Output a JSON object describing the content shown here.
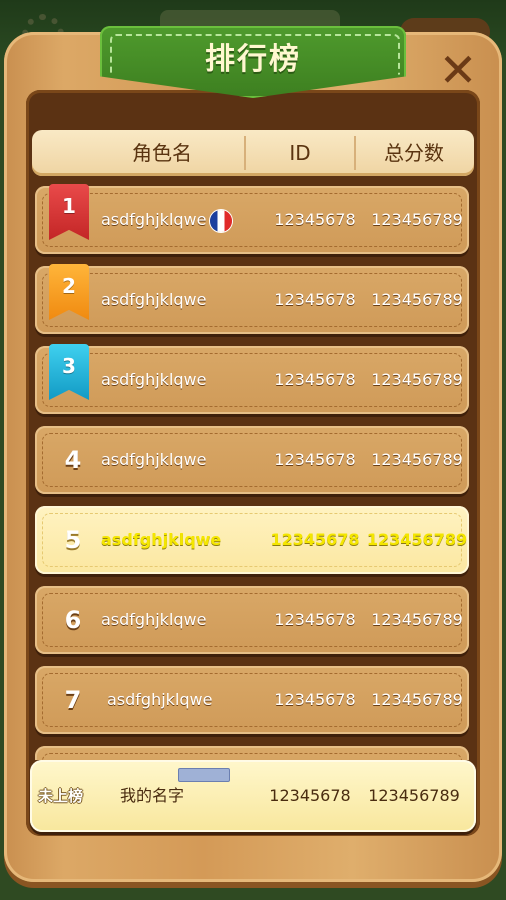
{
  "window": {
    "title": "排行榜"
  },
  "header": {
    "col_name": "角色名",
    "col_id": "ID",
    "col_score": "总分数"
  },
  "rows": [
    {
      "rank": "1",
      "name": "asdfghjklqwe",
      "id": "12345678",
      "score": "123456789",
      "badge": "red",
      "flag": "france-flag-icon"
    },
    {
      "rank": "2",
      "name": "asdfghjklqwe",
      "id": "12345678",
      "score": "123456789",
      "badge": "orange"
    },
    {
      "rank": "3",
      "name": "asdfghjklqwe",
      "id": "12345678",
      "score": "123456789",
      "badge": "cyan"
    },
    {
      "rank": "4",
      "name": "asdfghjklqwe",
      "id": "12345678",
      "score": "123456789"
    },
    {
      "rank": "5",
      "name": "asdfghjklqwe",
      "id": "12345678",
      "score": "123456789",
      "highlight": true
    },
    {
      "rank": "6",
      "name": "asdfghjklqwe",
      "id": "12345678",
      "score": "123456789"
    },
    {
      "rank": "7",
      "name": "asdfghjklqwe",
      "id": "12345678",
      "score": "123456789"
    }
  ],
  "my_row": {
    "rank_text": "未上榜",
    "name": "我的名字",
    "id": "12345678",
    "score": "123456789"
  },
  "colors": {
    "ribbon": "#4f9b2d",
    "wood": "#d49a57",
    "highlight_text": "#f4e600",
    "rank1": "#c32626",
    "rank2": "#f08a10",
    "rank3": "#129ac4"
  }
}
